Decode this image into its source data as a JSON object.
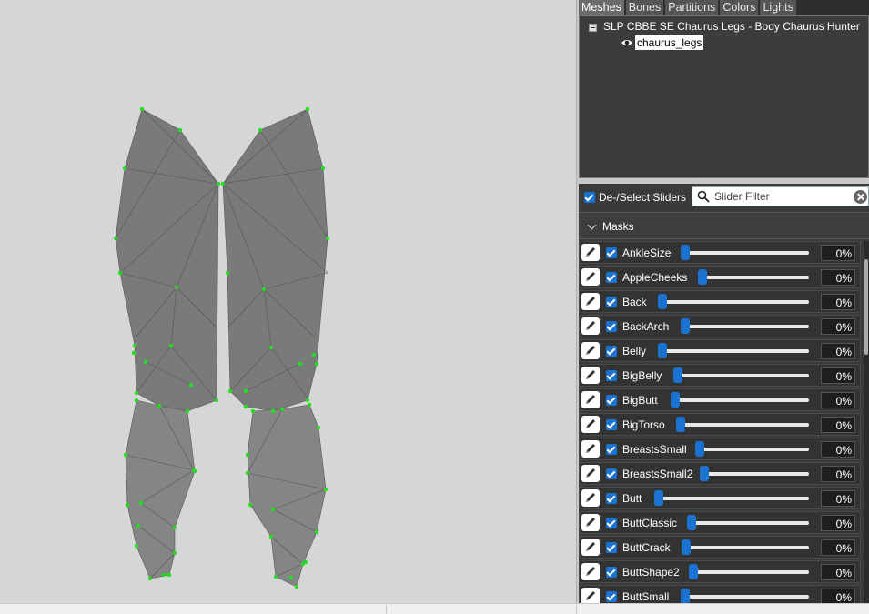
{
  "tabs": [
    {
      "label": "Meshes",
      "active": true
    },
    {
      "label": "Bones",
      "active": false
    },
    {
      "label": "Partitions",
      "active": false
    },
    {
      "label": "Colors",
      "active": false
    },
    {
      "label": "Lights",
      "active": false
    }
  ],
  "tree": {
    "root_label": "SLP CBBE SE Chaurus Legs - Body Chaurus Hunter",
    "mesh_label": "chaurus_legs"
  },
  "filter": {
    "deselect_label": "De-/Select Sliders",
    "search_placeholder": "Slider Filter"
  },
  "masks_label": "Masks",
  "sliders": [
    {
      "name": "AnkleSize",
      "value": "0%"
    },
    {
      "name": "AppleCheeks",
      "value": "0%"
    },
    {
      "name": "Back",
      "value": "0%"
    },
    {
      "name": "BackArch",
      "value": "0%"
    },
    {
      "name": "Belly",
      "value": "0%"
    },
    {
      "name": "BigBelly",
      "value": "0%"
    },
    {
      "name": "BigButt",
      "value": "0%"
    },
    {
      "name": "BigTorso",
      "value": "0%"
    },
    {
      "name": "BreastsSmall",
      "value": "0%"
    },
    {
      "name": "BreastsSmall2",
      "value": "0%"
    },
    {
      "name": "Butt",
      "value": "0%"
    },
    {
      "name": "ButtClassic",
      "value": "0%"
    },
    {
      "name": "ButtCrack",
      "value": "0%"
    },
    {
      "name": "ButtShape2",
      "value": "0%"
    },
    {
      "name": "ButtSmall",
      "value": "0%"
    }
  ],
  "colors": {
    "accent": "#1a73d0",
    "vertex": "#22dd22",
    "mesh": "#7a7a7a"
  }
}
